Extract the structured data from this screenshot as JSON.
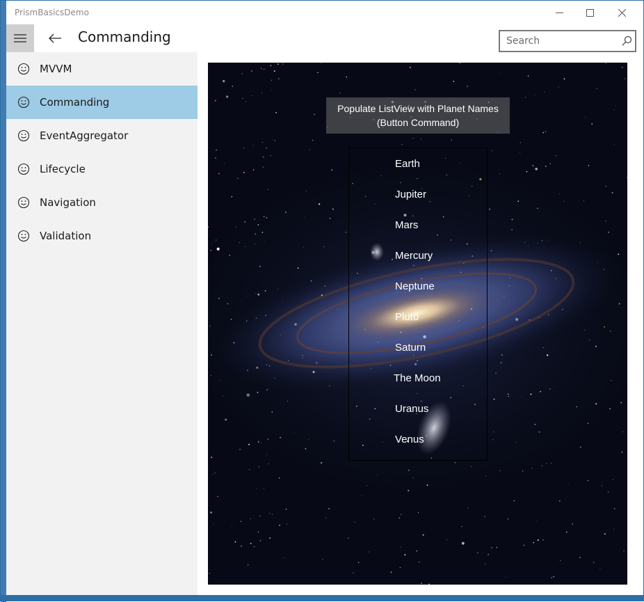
{
  "app": {
    "title": "PrismBasicsDemo"
  },
  "header": {
    "page_title": "Commanding",
    "search_placeholder": "Search"
  },
  "sidebar": {
    "items": [
      {
        "label": "MVVM",
        "selected": false
      },
      {
        "label": "Commanding",
        "selected": true
      },
      {
        "label": "EventAggregator",
        "selected": false
      },
      {
        "label": "Lifecycle",
        "selected": false
      },
      {
        "label": "Navigation",
        "selected": false
      },
      {
        "label": "Validation",
        "selected": false
      }
    ]
  },
  "main": {
    "button_line1": "Populate ListView with Planet Names",
    "button_line2": "(Button Command)",
    "planets": [
      "Earth",
      "Jupiter",
      "Mars",
      "Mercury",
      "Neptune",
      "Pluto",
      "Saturn",
      "The Moon",
      "Uranus",
      "Venus"
    ]
  },
  "colors": {
    "accent_border": "#2b6ea8",
    "selected_item": "#9ecbe5",
    "sidebar_bg": "#f2f2f2",
    "hamburger_bg": "#cfcfcf"
  },
  "icons": {
    "nav_item": "smiley-icon",
    "back": "arrow-left-icon",
    "menu": "hamburger-icon",
    "search": "search-icon"
  }
}
